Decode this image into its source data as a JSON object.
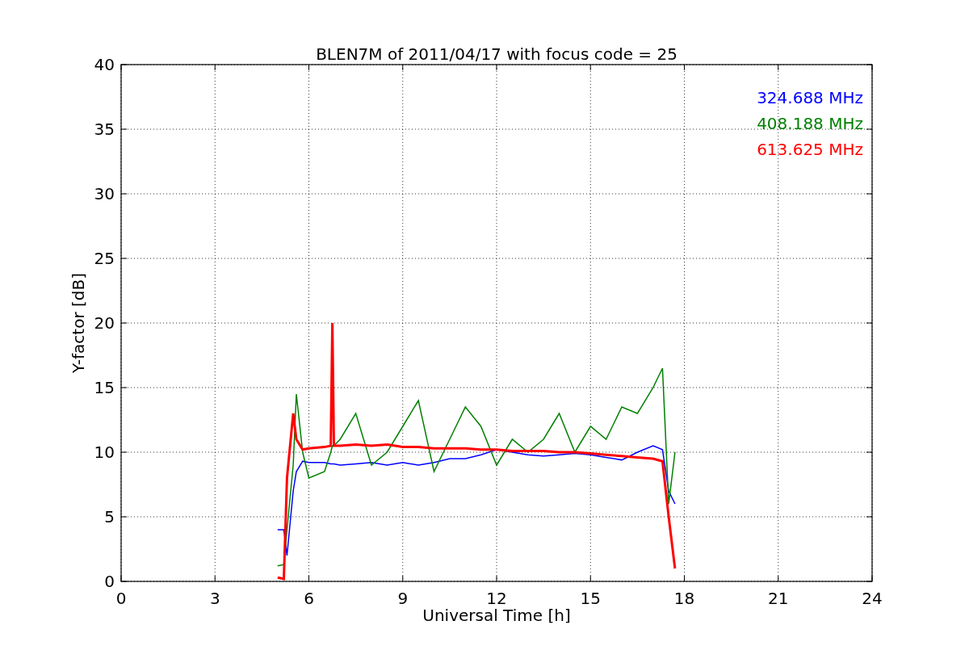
{
  "figure": {
    "chart_data": {
      "type": "line",
      "title": "BLEN7M of 2011/04/17 with focus code = 25",
      "xlabel": "Universal Time [h]",
      "ylabel": "Y-factor [dB]",
      "x": [
        5,
        5.2,
        5.3,
        5.5,
        5.6,
        5.8,
        6,
        6.5,
        6.7,
        6.75,
        6.8,
        7,
        7.5,
        8,
        8.5,
        9,
        9.5,
        10,
        10.5,
        11,
        11.5,
        12,
        12.5,
        13,
        13.5,
        14,
        14.5,
        15,
        15.5,
        16,
        16.5,
        17,
        17.3,
        17.5,
        17.7
      ],
      "series": [
        {
          "name": "324.688 MHz",
          "color": "#0000ff",
          "values": [
            4,
            4,
            2,
            7,
            8.5,
            9.3,
            9.2,
            9.2,
            9.1,
            9.1,
            9.1,
            9,
            9.1,
            9.2,
            9,
            9.2,
            9,
            9.2,
            9.5,
            9.5,
            9.8,
            10.2,
            10,
            9.8,
            9.7,
            9.8,
            9.9,
            9.8,
            9.6,
            9.4,
            10,
            10.5,
            10.2,
            7,
            6
          ]
        },
        {
          "name": "408.188 MHz",
          "color": "#008000",
          "values": [
            1.2,
            1.3,
            4,
            9,
            14.5,
            10,
            8,
            8.5,
            10,
            10.5,
            10.5,
            11,
            13,
            9,
            10,
            12,
            14,
            8.5,
            11,
            13.5,
            12,
            9,
            11,
            10,
            11,
            13,
            10,
            12,
            11,
            13.5,
            13,
            15,
            16.5,
            6,
            10
          ]
        },
        {
          "name": "613.625 MHz",
          "color": "#ff0000",
          "values": [
            0.3,
            0.2,
            8,
            13,
            11,
            10.2,
            10.3,
            10.4,
            10.5,
            20,
            10.5,
            10.5,
            10.6,
            10.5,
            10.6,
            10.4,
            10.4,
            10.3,
            10.3,
            10.3,
            10.2,
            10.2,
            10.1,
            10.1,
            10.1,
            10,
            10,
            9.9,
            9.8,
            9.7,
            9.6,
            9.5,
            9.3,
            5,
            1
          ]
        }
      ],
      "grid": true,
      "xlim": [
        0,
        24
      ],
      "ylim": [
        0,
        40
      ],
      "xticks": [
        0,
        3,
        6,
        9,
        12,
        15,
        18,
        21,
        24
      ],
      "yticks": [
        0,
        5,
        10,
        15,
        20,
        25,
        30,
        35,
        40
      ]
    }
  }
}
